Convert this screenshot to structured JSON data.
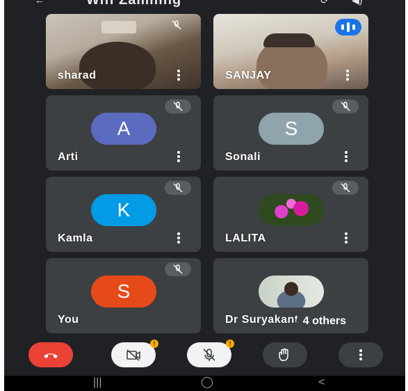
{
  "header": {
    "title": "Wifi Zamiling"
  },
  "participants": [
    {
      "name": "sharad",
      "type": "video",
      "muted": true
    },
    {
      "name": "SANJAY",
      "type": "video",
      "speaking": true
    },
    {
      "name": "Arti",
      "initial": "A",
      "avatar_color": "#5c6bc0",
      "muted": true
    },
    {
      "name": "Sonali",
      "initial": "S",
      "avatar_color": "#90a4ae",
      "muted": true
    },
    {
      "name": "Kamla",
      "initial": "K",
      "avatar_color": "#039be5",
      "muted": true
    },
    {
      "name": "LALITA",
      "avatar_icon": "orchid-photo",
      "muted": true
    },
    {
      "name": "You",
      "initial": "S",
      "avatar_color": "#e64a19",
      "muted": true
    },
    {
      "name": "Dr Suryakant",
      "avatar_icon": "profile-photo"
    }
  ],
  "others_label": "4 others",
  "controls": {
    "camera_badge": "!",
    "mic_badge": "!",
    "icons": [
      "end-call-icon",
      "camera-off-icon",
      "mic-off-icon",
      "raise-hand-icon",
      "more-options-icon"
    ]
  },
  "navbar": {
    "recents": "|||",
    "home": "◯",
    "back": "<"
  },
  "colors": {
    "background": "#202124",
    "tile": "#3c4043",
    "end_call": "#ea4335",
    "speaking": "#1a73e8"
  }
}
